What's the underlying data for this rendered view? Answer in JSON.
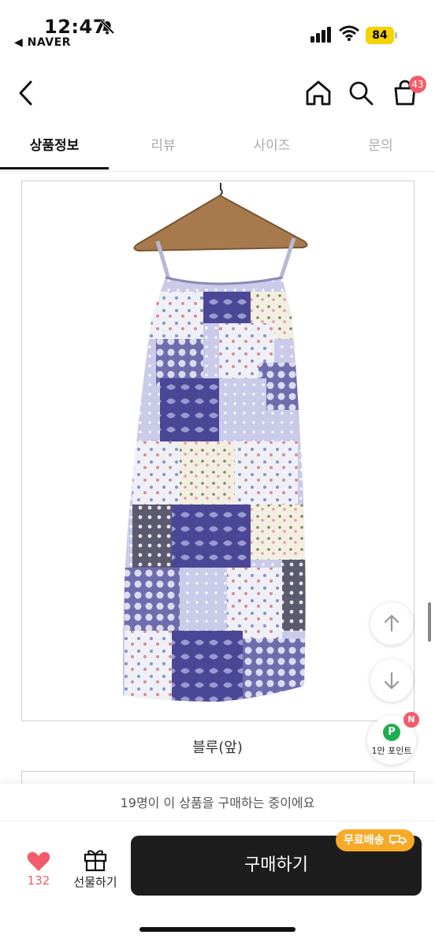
{
  "status_bar": {
    "time": "12:47",
    "back_app": "◀ NAVER",
    "battery": "84"
  },
  "nav": {
    "cart_badge": "43"
  },
  "tabs": [
    {
      "label": "상품정보",
      "active": true
    },
    {
      "label": "리뷰",
      "active": false
    },
    {
      "label": "사이즈",
      "active": false
    },
    {
      "label": "문의",
      "active": false
    }
  ],
  "product": {
    "caption": "블루(앞)"
  },
  "floating": {
    "point_label": "1만 포인트",
    "point_icon": "P",
    "point_new": "N"
  },
  "bottom_bar": {
    "buyers_note": "19명이 이 상품을 구매하는 중이에요",
    "like_count": "132",
    "gift_label": "선물하기",
    "buy_label": "구매하기",
    "shipping_badge": "무료배송"
  },
  "colors": {
    "accent_red": "#f25c6a",
    "buy_button": "#1d1d1d",
    "shipping_badge": "#f7a928",
    "point_green": "#1fae4e"
  }
}
